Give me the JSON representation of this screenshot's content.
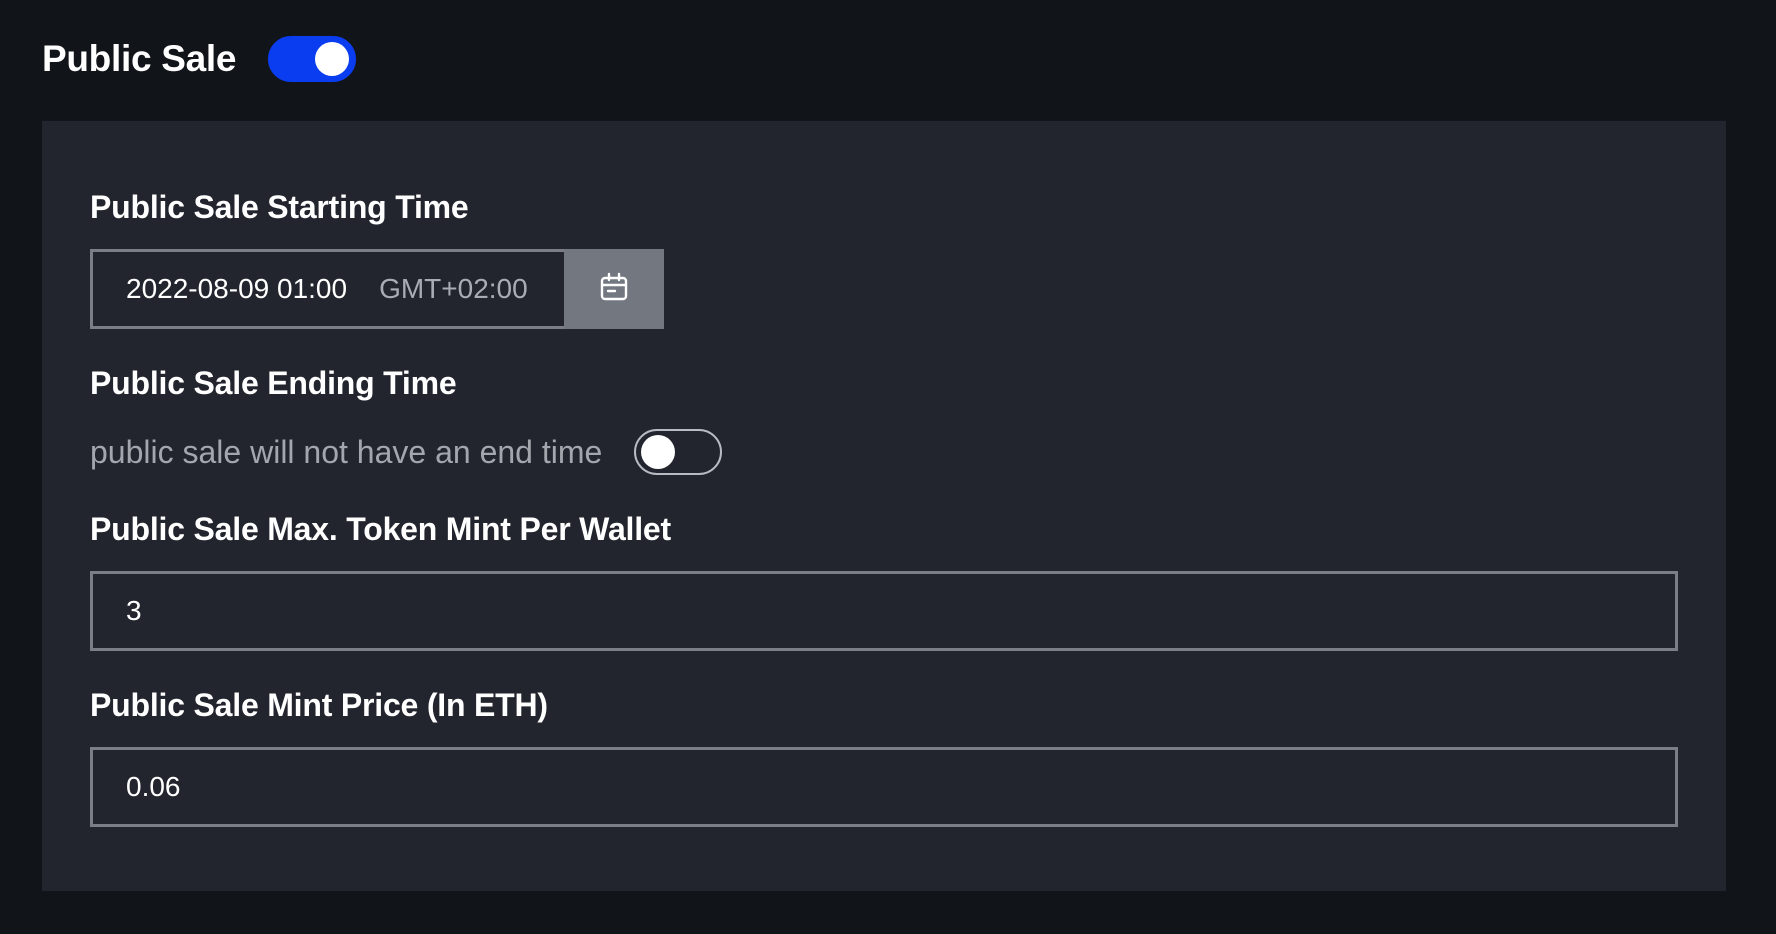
{
  "header": {
    "title": "Public Sale",
    "toggle_on": true
  },
  "starting_time": {
    "label": "Public Sale Starting Time",
    "value": "2022-08-09 01:00",
    "timezone": "GMT+02:00"
  },
  "ending_time": {
    "label": "Public Sale Ending Time",
    "note": "public sale will not have an end time",
    "toggle_on": false
  },
  "max_mint": {
    "label": "Public Sale Max. Token Mint Per Wallet",
    "value": "3"
  },
  "mint_price": {
    "label": "Public Sale Mint Price (In ETH)",
    "value": "0.06"
  },
  "colors": {
    "background": "#111418",
    "panel": "#22252e",
    "accent": "#0a3df0",
    "border": "#7b7e86",
    "calendar_button": "#737780"
  },
  "icons": {
    "calendar": "calendar-icon"
  }
}
